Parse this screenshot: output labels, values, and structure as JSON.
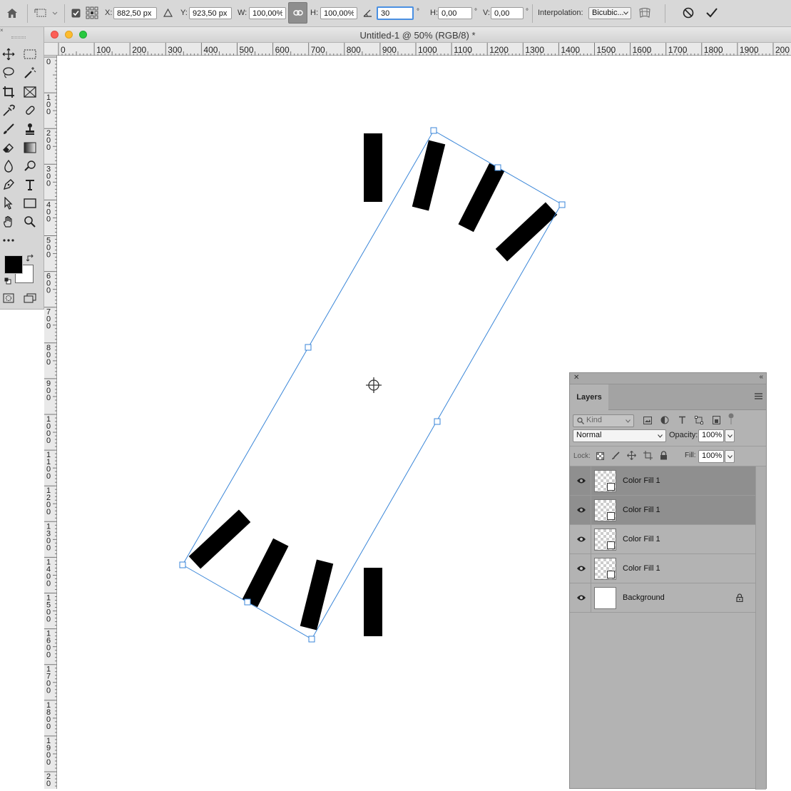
{
  "options_bar": {
    "x_label": "X:",
    "x_value": "882,50 px",
    "y_label": "Y:",
    "y_value": "923,50 px",
    "w_label": "W:",
    "w_value": "100,00%",
    "h_label": "H:",
    "h_value": "100,00%",
    "angle_value": "30",
    "angle_unit": "°",
    "skew_h_label": "H:",
    "skew_h_value": "0,00",
    "skew_v_label": "V:",
    "skew_v_value": "0,00",
    "interpolation_label": "Interpolation:",
    "interpolation_value": "Bicubic..."
  },
  "document": {
    "title": "Untitled-1 @ 50% (RGB/8) *"
  },
  "ruler": {
    "h_ticks": [
      "0",
      "100",
      "200",
      "300",
      "400",
      "500",
      "600",
      "700",
      "800",
      "900",
      "1000",
      "1100",
      "1200",
      "1300",
      "1400",
      "1500",
      "1600",
      "1700",
      "1800",
      "1900",
      "200"
    ],
    "v_ticks": [
      "0",
      "100",
      "200",
      "300",
      "400",
      "500",
      "600",
      "700",
      "800",
      "900",
      "1000",
      "1100",
      "1200",
      "1300",
      "1400",
      "1500",
      "1600",
      "1700",
      "1800",
      "1900",
      "20"
    ]
  },
  "layers_panel": {
    "tab_label": "Layers",
    "filter_kind": "Kind",
    "blend_mode": "Normal",
    "opacity_label": "Opacity:",
    "opacity_value": "100%",
    "lock_label": "Lock:",
    "fill_label": "Fill:",
    "fill_value": "100%",
    "layers": [
      {
        "name": "Color Fill 1",
        "selected": true
      },
      {
        "name": "Color Fill 1",
        "selected": true
      },
      {
        "name": "Color Fill 1",
        "selected": false
      },
      {
        "name": "Color Fill 1",
        "selected": false
      },
      {
        "name": "Background",
        "selected": false
      }
    ]
  },
  "colors": {
    "foreground": "#000000",
    "background": "#ffffff",
    "transform_box": "#3a86d8",
    "selected_layer": "#8f8f8f"
  }
}
